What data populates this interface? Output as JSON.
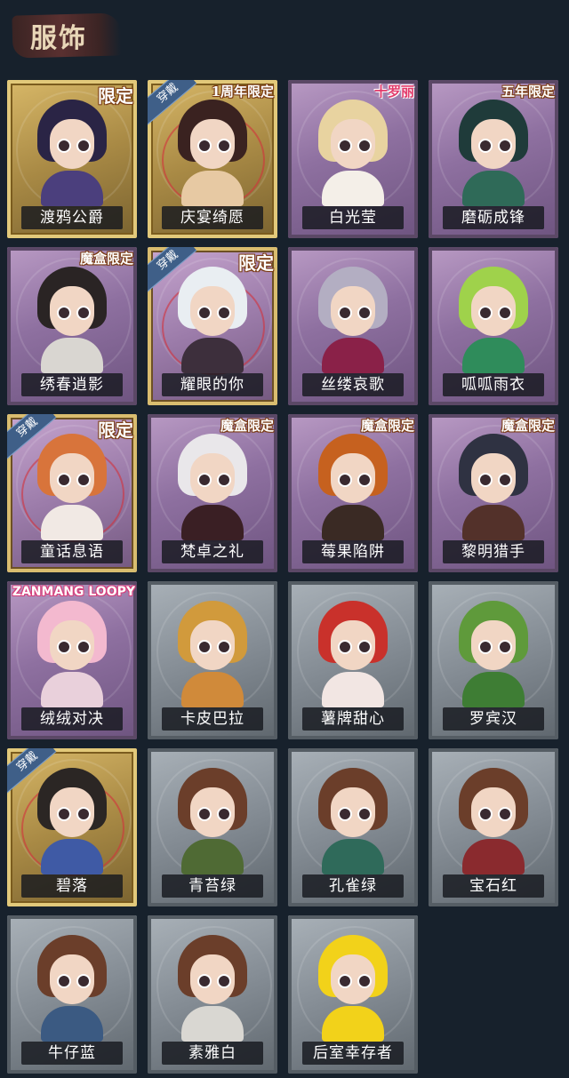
{
  "header": {
    "title": "服饰"
  },
  "items": [
    {
      "name": "渡鸦公爵",
      "badge": "限定",
      "wear": "",
      "style": "gold",
      "hair": "#2a2445",
      "body": "#4b3f7d"
    },
    {
      "name": "庆宴绮愿",
      "badge": "1周年限定",
      "wear": "穿戴",
      "style": "gold",
      "hair": "#3a2220",
      "body": "#e7c9a3"
    },
    {
      "name": "白光莹",
      "badge": "十罗丽",
      "wear": "",
      "style": "purple",
      "hair": "#e8d3a0",
      "body": "#f4efe8"
    },
    {
      "name": "磨砺成锋",
      "badge": "五年限定",
      "wear": "",
      "style": "purple",
      "hair": "#1f3b3a",
      "body": "#2f6a58"
    },
    {
      "name": "绣春逍影",
      "badge": "魔盒限定",
      "wear": "",
      "style": "purple",
      "hair": "#2a2424",
      "body": "#d9d6d1"
    },
    {
      "name": "耀眼的你",
      "badge": "限定",
      "wear": "穿戴",
      "style": "goldpurple",
      "hair": "#e9eef2",
      "body": "#3d2f3c"
    },
    {
      "name": "丝缕哀歌",
      "badge": "",
      "wear": "",
      "style": "purple",
      "hair": "#b3aec2",
      "body": "#8a2148"
    },
    {
      "name": "呱呱雨衣",
      "badge": "",
      "wear": "",
      "style": "purple",
      "hair": "#9fd24b",
      "body": "#2f8c5b"
    },
    {
      "name": "童话息语",
      "badge": "限定",
      "wear": "穿戴",
      "style": "goldpurple",
      "hair": "#d8743b",
      "body": "#f1e9e4"
    },
    {
      "name": "梵卓之礼",
      "badge": "魔盒限定",
      "wear": "",
      "style": "purple",
      "hair": "#e9e7ea",
      "body": "#3a1f24"
    },
    {
      "name": "莓果陷阱",
      "badge": "魔盒限定",
      "wear": "",
      "style": "purple",
      "hair": "#c6611f",
      "body": "#3a2a24"
    },
    {
      "name": "黎明猎手",
      "badge": "魔盒限定",
      "wear": "",
      "style": "purple",
      "hair": "#2f3242",
      "body": "#53312a"
    },
    {
      "name": "绒绒对决",
      "badge": "ZANMANG LOOPY",
      "wear": "",
      "style": "purple",
      "hair": "#f3b9cf",
      "body": "#e9d0db"
    },
    {
      "name": "卡皮巴拉",
      "badge": "",
      "wear": "",
      "style": "gray",
      "hair": "#d19a3c",
      "body": "#d08a3a"
    },
    {
      "name": "薯牌甜心",
      "badge": "",
      "wear": "",
      "style": "gray",
      "hair": "#c9312b",
      "body": "#f2e6e3"
    },
    {
      "name": "罗宾汉",
      "badge": "",
      "wear": "",
      "style": "gray",
      "hair": "#5f9a3b",
      "body": "#3e7d34"
    },
    {
      "name": "碧落",
      "badge": "",
      "wear": "穿戴",
      "style": "gold",
      "hair": "#2b2624",
      "body": "#3f5aa5"
    },
    {
      "name": "青苔绿",
      "badge": "",
      "wear": "",
      "style": "gray",
      "hair": "#6b3e2a",
      "body": "#4f6a34"
    },
    {
      "name": "孔雀绿",
      "badge": "",
      "wear": "",
      "style": "gray",
      "hair": "#6b3e2a",
      "body": "#2f6a5a"
    },
    {
      "name": "宝石红",
      "badge": "",
      "wear": "",
      "style": "gray",
      "hair": "#6b3e2a",
      "body": "#8a2a2e"
    },
    {
      "name": "牛仔蓝",
      "badge": "",
      "wear": "",
      "style": "gray",
      "hair": "#6b3e2a",
      "body": "#3b5a82"
    },
    {
      "name": "素雅白",
      "badge": "",
      "wear": "",
      "style": "gray",
      "hair": "#6b3e2a",
      "body": "#d9d7d2"
    },
    {
      "name": "后室幸存者",
      "badge": "",
      "wear": "",
      "style": "gray",
      "hair": "#f2d21a",
      "body": "#f2d21a"
    }
  ]
}
